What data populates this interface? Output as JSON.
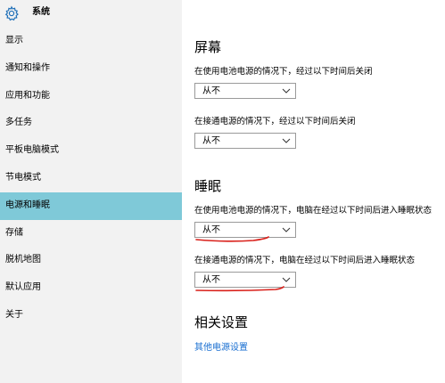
{
  "header": {
    "icon": "gear-icon",
    "title": "系统"
  },
  "sidebar": {
    "items": [
      {
        "label": "显示"
      },
      {
        "label": "通知和操作"
      },
      {
        "label": "应用和功能"
      },
      {
        "label": "多任务"
      },
      {
        "label": "平板电脑模式"
      },
      {
        "label": "节电模式"
      },
      {
        "label": "电源和睡眠",
        "active": true
      },
      {
        "label": "存储"
      },
      {
        "label": "脱机地图"
      },
      {
        "label": "默认应用"
      },
      {
        "label": "关于"
      }
    ]
  },
  "main": {
    "screen": {
      "title": "屏幕",
      "battery_label": "在使用电池电源的情况下，经过以下时间后关闭",
      "battery_value": "从不",
      "plugged_label": "在接通电源的情况下，经过以下时间后关闭",
      "plugged_value": "从不"
    },
    "sleep": {
      "title": "睡眠",
      "battery_label": "在使用电池电源的情况下，电脑在经过以下时间后进入睡眠状态",
      "battery_value": "从不",
      "plugged_label": "在接通电源的情况下，电脑在经过以下时间后进入睡眠状态",
      "plugged_value": "从不"
    },
    "related": {
      "title": "相关设置",
      "link": "其他电源设置"
    }
  },
  "colors": {
    "sidebar_bg": "#f2f2f2",
    "active_bg": "#7fc9d8",
    "link": "#1a6fd1",
    "annotation": "#d9201a"
  }
}
